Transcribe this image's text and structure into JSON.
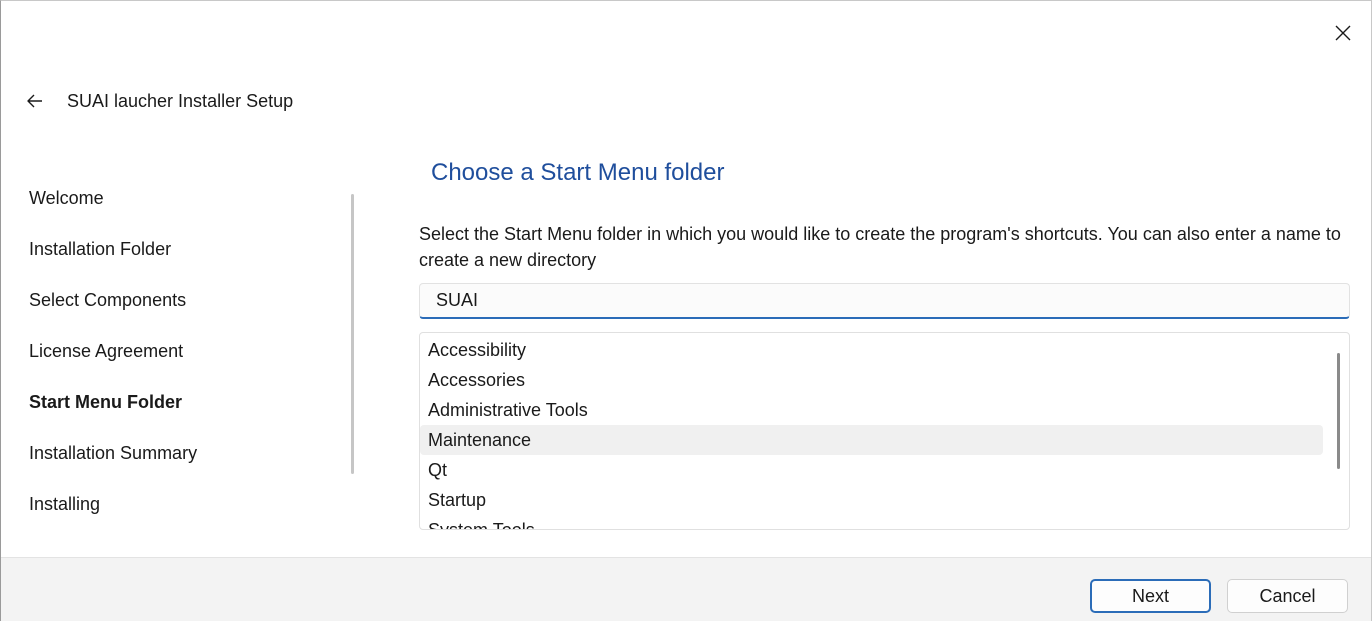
{
  "window": {
    "title": "SUAI laucher Installer Setup",
    "close_icon": "close-icon",
    "back_icon": "arrow-left-icon"
  },
  "sidebar": {
    "items": [
      {
        "label": "Welcome",
        "active": false
      },
      {
        "label": "Installation Folder",
        "active": false
      },
      {
        "label": "Select Components",
        "active": false
      },
      {
        "label": "License Agreement",
        "active": false
      },
      {
        "label": "Start Menu Folder",
        "active": true
      },
      {
        "label": "Installation Summary",
        "active": false
      },
      {
        "label": "Installing",
        "active": false
      }
    ]
  },
  "main": {
    "heading": "Choose a Start Menu folder",
    "description": "Select the Start Menu folder in which you would like to create the program's shortcuts. You can also enter a name to create a new directory",
    "folder_input": {
      "value": "SUAI"
    },
    "folder_list": [
      "Accessibility",
      "Accessories",
      "Administrative Tools",
      "Maintenance",
      "Qt",
      "Startup",
      "System Tools"
    ],
    "hovered_item": "Maintenance"
  },
  "footer": {
    "next_label": "Next",
    "cancel_label": "Cancel"
  },
  "colors": {
    "accent": "#2b6cb8",
    "heading": "#1f4e9c",
    "footer_bg": "#f3f3f3"
  }
}
